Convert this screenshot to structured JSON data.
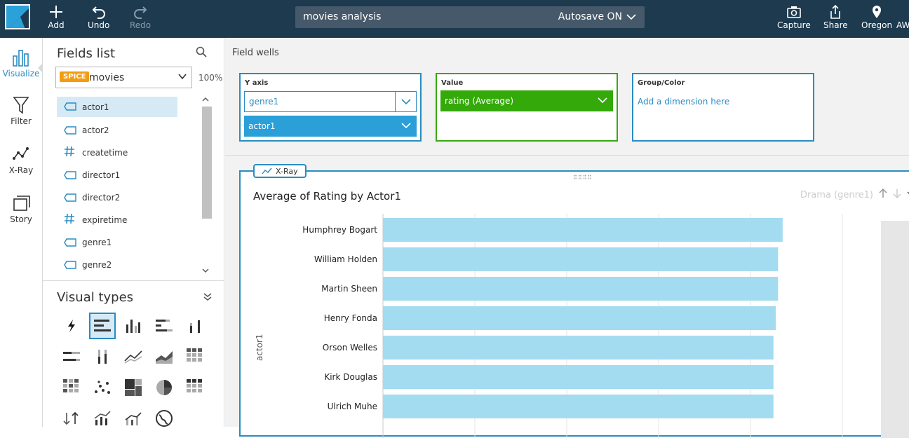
{
  "topbar": {
    "add_label": "Add",
    "undo_label": "Undo",
    "redo_label": "Redo",
    "analysis_name": "movies analysis",
    "autosave_label": "Autosave ON",
    "capture_label": "Capture",
    "share_label": "Share",
    "region_label": "Oregon",
    "account_label": "AW"
  },
  "rail": {
    "visualize": "Visualize",
    "filter": "Filter",
    "xray": "X-Ray",
    "story": "Story"
  },
  "fields_panel": {
    "title": "Fields list",
    "dataset_badge": "SPICE",
    "dataset_name": "movies",
    "percent": "100%",
    "fields": [
      {
        "name": "actor1",
        "type": "dimension"
      },
      {
        "name": "actor2",
        "type": "dimension"
      },
      {
        "name": "createtime",
        "type": "measure"
      },
      {
        "name": "director1",
        "type": "dimension"
      },
      {
        "name": "director2",
        "type": "dimension"
      },
      {
        "name": "expiretime",
        "type": "measure"
      },
      {
        "name": "genre1",
        "type": "dimension"
      },
      {
        "name": "genre2",
        "type": "dimension"
      }
    ]
  },
  "visual_types": {
    "title": "Visual types"
  },
  "field_wells": {
    "label": "Field wells",
    "y_axis": {
      "label": "Y axis",
      "field1": "genre1",
      "field2": "actor1"
    },
    "value": {
      "label": "Value",
      "field": "rating (Average)"
    },
    "group": {
      "label": "Group/Color",
      "placeholder": "Add a dimension here"
    }
  },
  "visual": {
    "xray_tag": "X-Ray",
    "drill_label": "Drama (genre1)",
    "colors": {
      "bar": "#a3dcf0",
      "accent": "#2a8cc1"
    }
  },
  "chart_data": {
    "type": "bar",
    "orientation": "horizontal",
    "title": "Average of Rating by Actor1",
    "ylabel": "actor1",
    "categories": [
      "Humphrey Bogart",
      "William Holden",
      "Martin Sheen",
      "Henry Fonda",
      "Orson Welles",
      "Kirk Douglas",
      "Ulrich Muhe"
    ],
    "values": [
      8.7,
      8.6,
      8.6,
      8.55,
      8.5,
      8.5,
      8.5
    ],
    "xlim": [
      0,
      10
    ],
    "grid": true
  }
}
